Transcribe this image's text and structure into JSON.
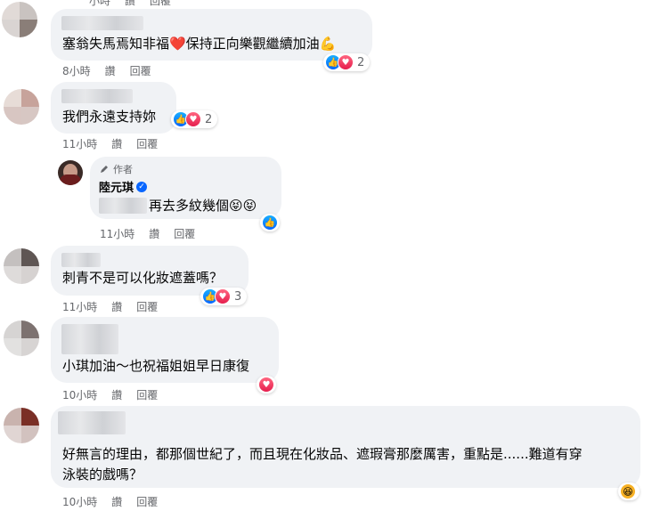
{
  "comments": [
    {
      "text": "塞翁失馬焉知非福❤️保持正向樂觀繼續加油💪",
      "time": "8小時",
      "like": "讚",
      "reply": "回覆",
      "reaction_count": "2"
    },
    {
      "text": "我們永遠支持妳",
      "time": "11小時",
      "like": "讚",
      "reply": "回覆",
      "reaction_count": "2"
    },
    {
      "author_badge": "作者",
      "author_name": "陸元琪",
      "text": "再去多紋幾個😝😝",
      "time": "11小時",
      "like": "讚",
      "reply": "回覆"
    },
    {
      "text": "刺青不是可以化妝遮蓋嗎？",
      "time": "11小時",
      "like": "讚",
      "reply": "回覆",
      "reaction_count": "3"
    },
    {
      "text": "小琪加油～也祝福姐姐早日康復",
      "time": "10小時",
      "like": "讚",
      "reply": "回覆"
    },
    {
      "text_line1": "好無言的理由，都那個世紀了，而且現在化妝品、遮瑕膏那麼厲害，重點是......難道有穿",
      "text_line2": "泳裝的戲嗎？",
      "time": "10小時",
      "like": "讚",
      "reply": "回覆"
    }
  ],
  "top_meta": {
    "time": "小時",
    "like": "讚",
    "reply": "回覆"
  },
  "icons": {
    "like": "like-reaction-icon",
    "love": "love-reaction-icon",
    "haha": "haha-reaction-icon",
    "pencil": "pencil-icon",
    "verified": "verified-badge-icon"
  },
  "colors": {
    "bubble": "#f0f2f5",
    "meta": "#65676b",
    "like": "#0866ff",
    "love": "#e61e4d"
  }
}
